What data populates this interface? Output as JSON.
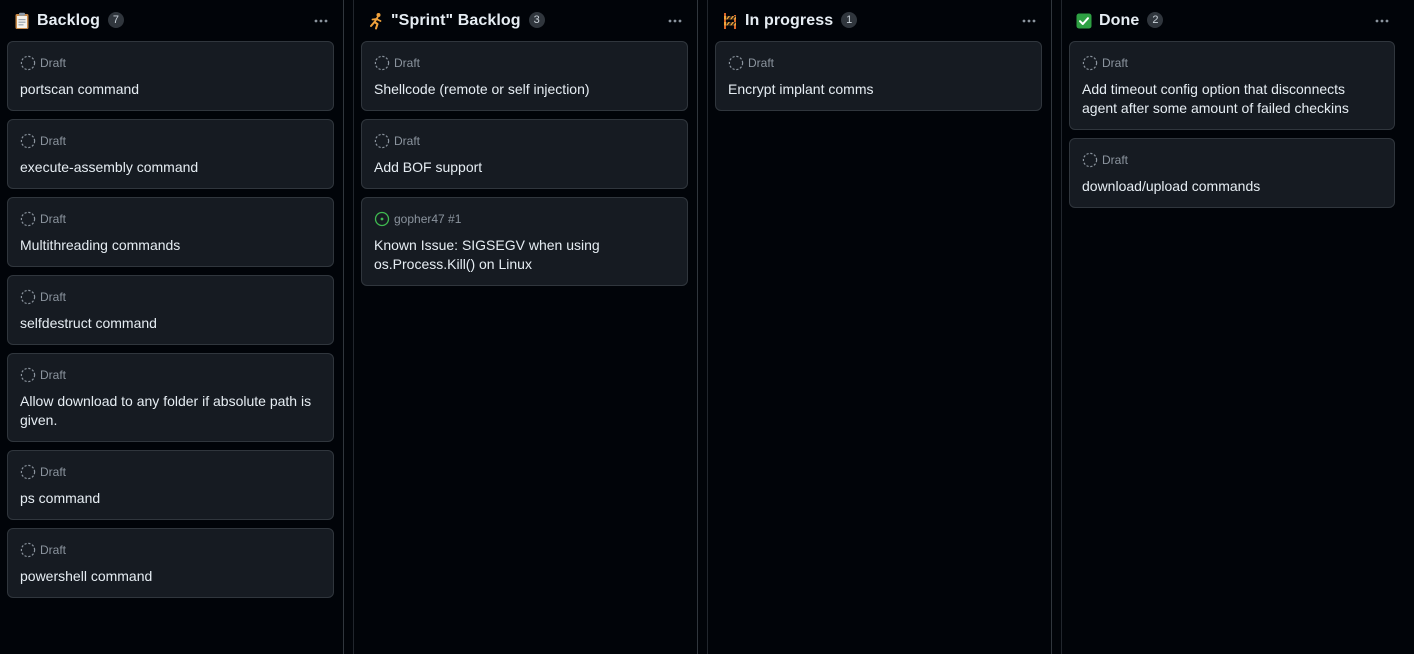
{
  "columns": [
    {
      "emoji": "clipboard-icon",
      "title": "Backlog",
      "count": "7",
      "cards": [
        {
          "type": "draft",
          "meta": "Draft",
          "title": "portscan command"
        },
        {
          "type": "draft",
          "meta": "Draft",
          "title": "execute-assembly command"
        },
        {
          "type": "draft",
          "meta": "Draft",
          "title": "Multithreading commands"
        },
        {
          "type": "draft",
          "meta": "Draft",
          "title": "selfdestruct command"
        },
        {
          "type": "draft",
          "meta": "Draft",
          "title": "Allow download to any folder if absolute path is given."
        },
        {
          "type": "draft",
          "meta": "Draft",
          "title": "ps command"
        },
        {
          "type": "draft",
          "meta": "Draft",
          "title": "powershell command"
        }
      ]
    },
    {
      "emoji": "runner-icon",
      "title": "\"Sprint\" Backlog",
      "count": "3",
      "cards": [
        {
          "type": "draft",
          "meta": "Draft",
          "title": "Shellcode (remote or self injection)"
        },
        {
          "type": "draft",
          "meta": "Draft",
          "title": "Add BOF support"
        },
        {
          "type": "issue",
          "meta": "gopher47 #1",
          "title": "Known Issue: SIGSEGV when using os.Process.Kill() on Linux"
        }
      ]
    },
    {
      "emoji": "construction-icon",
      "title": "In progress",
      "count": "1",
      "cards": [
        {
          "type": "draft",
          "meta": "Draft",
          "title": "Encrypt implant comms"
        }
      ]
    },
    {
      "emoji": "check-mark-icon",
      "title": "Done",
      "count": "2",
      "cards": [
        {
          "type": "draft",
          "meta": "Draft",
          "title": "Add timeout config option that disconnects agent after some amount of failed checkins"
        },
        {
          "type": "draft",
          "meta": "Draft",
          "title": "download/upload commands"
        }
      ]
    }
  ],
  "colors": {
    "background": "#010409",
    "card": "#161b22",
    "border": "#30363d",
    "text": "#e6edf3",
    "muted": "#8b949e",
    "open_issue": "#3fb950",
    "done_check": "#238636"
  }
}
